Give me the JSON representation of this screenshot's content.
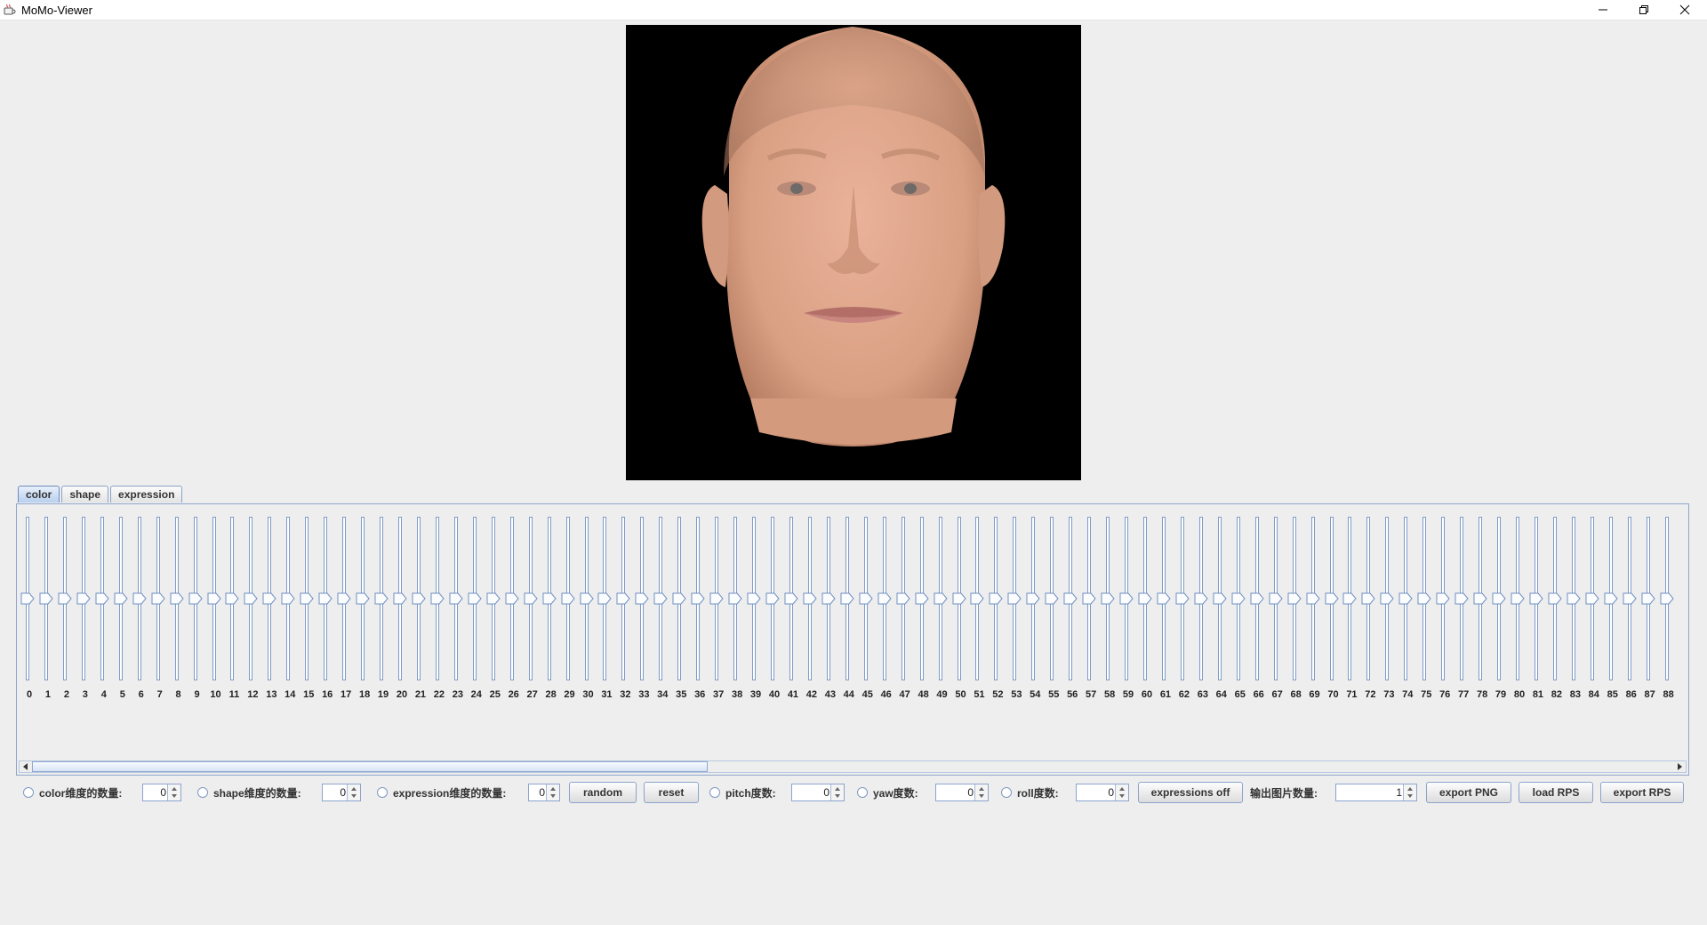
{
  "window": {
    "title": "MoMo-Viewer",
    "controls": [
      "minimize",
      "restore",
      "close"
    ]
  },
  "tabs": [
    {
      "label": "color",
      "active": true
    },
    {
      "label": "shape",
      "active": false
    },
    {
      "label": "expression",
      "active": false
    }
  ],
  "sliders": {
    "labels": [
      "0",
      "1",
      "2",
      "3",
      "4",
      "5",
      "6",
      "7",
      "8",
      "9",
      "10",
      "11",
      "12",
      "13",
      "14",
      "15",
      "16",
      "17",
      "18",
      "19",
      "20",
      "21",
      "22",
      "23",
      "24",
      "25",
      "26",
      "27",
      "28",
      "29",
      "30",
      "31",
      "32",
      "33",
      "34",
      "35",
      "36",
      "37",
      "38",
      "39",
      "40",
      "41",
      "42",
      "43",
      "44",
      "45",
      "46",
      "47",
      "48",
      "49",
      "50",
      "51",
      "52",
      "53",
      "54",
      "55",
      "56",
      "57",
      "58",
      "59",
      "60",
      "61",
      "62",
      "63",
      "64",
      "65",
      "66",
      "67",
      "68",
      "69",
      "70",
      "71",
      "72",
      "73",
      "74",
      "75",
      "76",
      "77",
      "78",
      "79",
      "80",
      "81",
      "82",
      "83",
      "84",
      "85",
      "86",
      "87",
      "88"
    ],
    "value": 0.5
  },
  "controls": {
    "color_dims_label": "color维度的数量:",
    "color_dims_value": "0",
    "shape_dims_label": "shape维度的数量:",
    "shape_dims_value": "0",
    "expression_dims_label": "expression维度的数量:",
    "expression_dims_value": "0",
    "random_label": "random",
    "reset_label": "reset",
    "pitch_label": "pitch度数:",
    "pitch_value": "0",
    "yaw_label": "yaw度数:",
    "yaw_value": "0",
    "roll_label": "roll度数:",
    "roll_value": "0",
    "expressions_off_label": "expressions off",
    "output_count_label": "输出图片数量:",
    "output_count_value": "1",
    "export_png_label": "export PNG",
    "load_rps_label": "load RPS",
    "export_rps_label": "export RPS"
  },
  "colors": {
    "accent": "#7e9bc7",
    "background": "#eeeeee",
    "viewport_bg": "#000000",
    "skin": "#e0a68a"
  },
  "icons": {
    "app": "java-cup-icon",
    "minimize": "minimize-icon",
    "restore": "restore-icon",
    "close": "close-icon"
  }
}
